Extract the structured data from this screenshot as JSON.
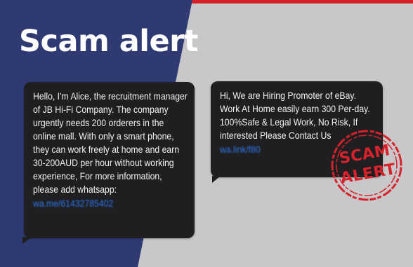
{
  "headline": "Scam alert",
  "messages": [
    {
      "text": "Hello, I'm Alice, the recruitment manager of JB Hi-Fi Company. The company urgently needs 200 orderers in the online mall. With only a smart phone, they can work freely at home and earn 30-200AUD per hour without working experience, For more information, please add whatsapp:",
      "link": "wa.me/61432785402"
    },
    {
      "text": "Hi, We are Hiring Promoter of eBay. Work At Home easily earn 300 Per-day. 100%Safe & Legal Work, No Risk, If interested Please Contact Us",
      "link": "wa.link/f80"
    }
  ],
  "stamp": {
    "line1": "SCAM",
    "line2": "ALERT"
  },
  "colors": {
    "navy": "#2f3a73",
    "grey_background": "#c8c8ca",
    "bubble": "#1f1f21",
    "link_blue": "#2f74e8",
    "alert_red": "#d8222b",
    "top_stripe": "#d62027"
  }
}
